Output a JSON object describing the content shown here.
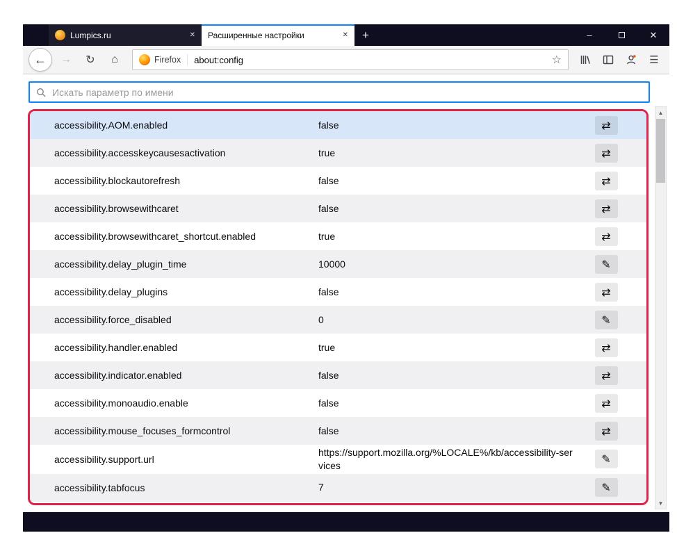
{
  "window": {
    "tabs": [
      {
        "title": "Lumpics.ru"
      },
      {
        "title": "Расширенные настройки"
      }
    ]
  },
  "toolbar": {
    "identity_label": "Firefox",
    "url": "about:config"
  },
  "search": {
    "placeholder": "Искать параметр по имени"
  },
  "prefs": {
    "rows": [
      {
        "name": "accessibility.AOM.enabled",
        "value": "false",
        "action": "toggle",
        "selected": true
      },
      {
        "name": "accessibility.accesskeycausesactivation",
        "value": "true",
        "action": "toggle"
      },
      {
        "name": "accessibility.blockautorefresh",
        "value": "false",
        "action": "toggle"
      },
      {
        "name": "accessibility.browsewithcaret",
        "value": "false",
        "action": "toggle"
      },
      {
        "name": "accessibility.browsewithcaret_shortcut.enabled",
        "value": "true",
        "action": "toggle"
      },
      {
        "name": "accessibility.delay_plugin_time",
        "value": "10000",
        "action": "edit"
      },
      {
        "name": "accessibility.delay_plugins",
        "value": "false",
        "action": "toggle"
      },
      {
        "name": "accessibility.force_disabled",
        "value": "0",
        "action": "edit"
      },
      {
        "name": "accessibility.handler.enabled",
        "value": "true",
        "action": "toggle"
      },
      {
        "name": "accessibility.indicator.enabled",
        "value": "false",
        "action": "toggle"
      },
      {
        "name": "accessibility.monoaudio.enable",
        "value": "false",
        "action": "toggle"
      },
      {
        "name": "accessibility.mouse_focuses_formcontrol",
        "value": "false",
        "action": "toggle"
      },
      {
        "name": "accessibility.support.url",
        "value": "https://support.mozilla.org/%LOCALE%/kb/accessibility-services",
        "action": "edit"
      },
      {
        "name": "accessibility.tabfocus",
        "value": "7",
        "action": "edit"
      }
    ]
  },
  "icons": {
    "toggle_glyph": "⇄",
    "edit_glyph": "✎"
  },
  "colors": {
    "accent_blue": "#0a84ff",
    "highlight_red": "#df2349",
    "selected_row": "#d7e6f9",
    "frame_dark": "#0f0e20"
  }
}
